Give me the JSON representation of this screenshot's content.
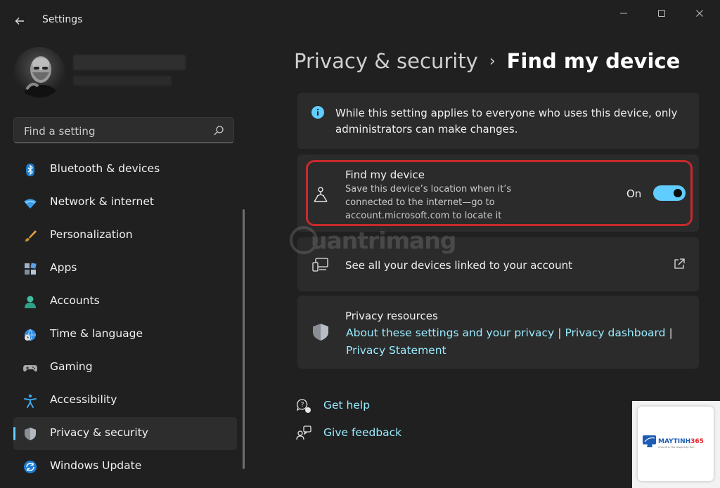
{
  "window": {
    "title": "Settings"
  },
  "search": {
    "placeholder": "Find a setting"
  },
  "sidebar": {
    "items": [
      {
        "label": "Bluetooth & devices",
        "icon": "bluetooth-icon"
      },
      {
        "label": "Network & internet",
        "icon": "wifi-icon"
      },
      {
        "label": "Personalization",
        "icon": "paintbrush-icon"
      },
      {
        "label": "Apps",
        "icon": "apps-icon"
      },
      {
        "label": "Accounts",
        "icon": "person-icon"
      },
      {
        "label": "Time & language",
        "icon": "globe-clock-icon"
      },
      {
        "label": "Gaming",
        "icon": "gamepad-icon"
      },
      {
        "label": "Accessibility",
        "icon": "accessibility-icon"
      },
      {
        "label": "Privacy & security",
        "icon": "shield-icon",
        "active": true
      },
      {
        "label": "Windows Update",
        "icon": "update-icon"
      }
    ]
  },
  "breadcrumb": {
    "parent": "Privacy & security",
    "separator": "›",
    "current": "Find my device"
  },
  "info_card": {
    "text": "While this setting applies to everyone who uses this device, only administrators can make changes."
  },
  "find_card": {
    "title": "Find my device",
    "description": "Save this device’s location when it’s connected to the internet—go to account.microsoft.com to locate it",
    "state_label": "On",
    "enabled": true
  },
  "devices_card": {
    "title": "See all your devices linked to your account"
  },
  "resources_card": {
    "title": "Privacy resources",
    "links": [
      "About these settings and your privacy",
      "Privacy dashboard",
      "Privacy Statement"
    ],
    "separator": "|"
  },
  "footer_links": {
    "help": "Get help",
    "feedback": "Give feedback"
  },
  "watermark": {
    "text": "uantrimang",
    "badge_brand": "MAYTINH",
    "badge_number": "365",
    "badge_sub": "Chia sẻ & Thủ thuật máy tính"
  },
  "colors": {
    "background": "#202020",
    "card": "#2b2b2b",
    "accent": "#60cdff",
    "link": "#99ebff",
    "highlight_border": "#c9292b"
  }
}
